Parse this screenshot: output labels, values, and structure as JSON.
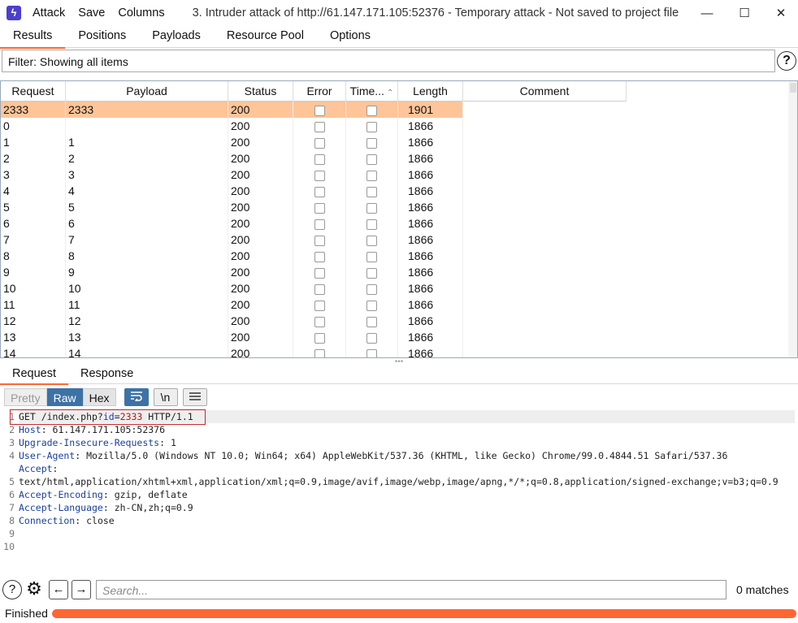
{
  "menu": [
    "Attack",
    "Save",
    "Columns"
  ],
  "window_title": "3. Intruder attack of http://61.147.171.105:52376 - Temporary attack - Not saved to project file",
  "top_tabs": [
    "Results",
    "Positions",
    "Payloads",
    "Resource Pool",
    "Options"
  ],
  "filter_text": "Filter: Showing all items",
  "table": {
    "columns": [
      "Request",
      "Payload",
      "Status",
      "Error",
      "Time...",
      "Length",
      "Comment"
    ],
    "rows": [
      {
        "request": "2333",
        "payload": "2333",
        "status": "200",
        "error": false,
        "timeout": false,
        "length": "1901",
        "comment": "",
        "selected": true
      },
      {
        "request": "0",
        "payload": "",
        "status": "200",
        "error": false,
        "timeout": false,
        "length": "1866",
        "comment": ""
      },
      {
        "request": "1",
        "payload": "1",
        "status": "200",
        "error": false,
        "timeout": false,
        "length": "1866",
        "comment": ""
      },
      {
        "request": "2",
        "payload": "2",
        "status": "200",
        "error": false,
        "timeout": false,
        "length": "1866",
        "comment": ""
      },
      {
        "request": "3",
        "payload": "3",
        "status": "200",
        "error": false,
        "timeout": false,
        "length": "1866",
        "comment": ""
      },
      {
        "request": "4",
        "payload": "4",
        "status": "200",
        "error": false,
        "timeout": false,
        "length": "1866",
        "comment": ""
      },
      {
        "request": "5",
        "payload": "5",
        "status": "200",
        "error": false,
        "timeout": false,
        "length": "1866",
        "comment": ""
      },
      {
        "request": "6",
        "payload": "6",
        "status": "200",
        "error": false,
        "timeout": false,
        "length": "1866",
        "comment": ""
      },
      {
        "request": "7",
        "payload": "7",
        "status": "200",
        "error": false,
        "timeout": false,
        "length": "1866",
        "comment": ""
      },
      {
        "request": "8",
        "payload": "8",
        "status": "200",
        "error": false,
        "timeout": false,
        "length": "1866",
        "comment": ""
      },
      {
        "request": "9",
        "payload": "9",
        "status": "200",
        "error": false,
        "timeout": false,
        "length": "1866",
        "comment": ""
      },
      {
        "request": "10",
        "payload": "10",
        "status": "200",
        "error": false,
        "timeout": false,
        "length": "1866",
        "comment": ""
      },
      {
        "request": "11",
        "payload": "11",
        "status": "200",
        "error": false,
        "timeout": false,
        "length": "1866",
        "comment": ""
      },
      {
        "request": "12",
        "payload": "12",
        "status": "200",
        "error": false,
        "timeout": false,
        "length": "1866",
        "comment": ""
      },
      {
        "request": "13",
        "payload": "13",
        "status": "200",
        "error": false,
        "timeout": false,
        "length": "1866",
        "comment": ""
      },
      {
        "request": "14",
        "payload": "14",
        "status": "200",
        "error": false,
        "timeout": false,
        "length": "1866",
        "comment": ""
      }
    ]
  },
  "message_tabs": [
    "Request",
    "Response"
  ],
  "view_buttons": [
    "Pretty",
    "Raw",
    "Hex"
  ],
  "toolbar_icons": [
    "wrap-lines-icon",
    "newline-toggle-icon",
    "menu-icon"
  ],
  "newline_label": "\\n",
  "request_lines": [
    [
      {
        "t": "GET /index.php?",
        "c": "plain"
      },
      {
        "t": "id",
        "c": "key"
      },
      {
        "t": "=",
        "c": "plain"
      },
      {
        "t": "2333",
        "c": "val"
      },
      {
        "t": " HTTP/1.1",
        "c": "plain"
      }
    ],
    [
      {
        "t": "Host",
        "c": "key"
      },
      {
        "t": ": 61.147.171.105:52376",
        "c": "plain"
      }
    ],
    [
      {
        "t": "Upgrade-Insecure-Requests",
        "c": "key"
      },
      {
        "t": ": 1",
        "c": "plain"
      }
    ],
    [
      {
        "t": "User-Agent",
        "c": "key"
      },
      {
        "t": ": Mozilla/5.0 (Windows NT 10.0; Win64; x64) AppleWebKit/537.36 (KHTML, like Gecko) Chrome/99.0.4844.51 Safari/537.36",
        "c": "plain"
      }
    ],
    [
      {
        "t": "Accept",
        "c": "key"
      },
      {
        "t": ":",
        "c": "plain"
      }
    ],
    [
      {
        "t": "text/html,application/xhtml+xml,application/xml;q=0.9,image/avif,image/webp,image/apng,*/*;q=0.8,application/signed-exchange;v=b3;q=0.9",
        "c": "plain"
      }
    ],
    [
      {
        "t": "Accept-Encoding",
        "c": "key"
      },
      {
        "t": ": gzip, deflate",
        "c": "plain"
      }
    ],
    [
      {
        "t": "Accept-Language",
        "c": "key"
      },
      {
        "t": ": zh-CN,zh;q=0.9",
        "c": "plain"
      }
    ],
    [
      {
        "t": "Connection",
        "c": "key"
      },
      {
        "t": ": close",
        "c": "plain"
      }
    ],
    [],
    []
  ],
  "line_numbers": [
    "1",
    "2",
    "3",
    "4",
    "",
    "5",
    "6",
    "7",
    "8",
    "9",
    "10"
  ],
  "search": {
    "placeholder": "Search...",
    "matches": "0 matches"
  },
  "status": "Finished",
  "progress_fraction": 1.0,
  "colors": {
    "accent": "#ff6633",
    "selected_row": "#ffc599",
    "raw_active": "#3d72a6"
  }
}
